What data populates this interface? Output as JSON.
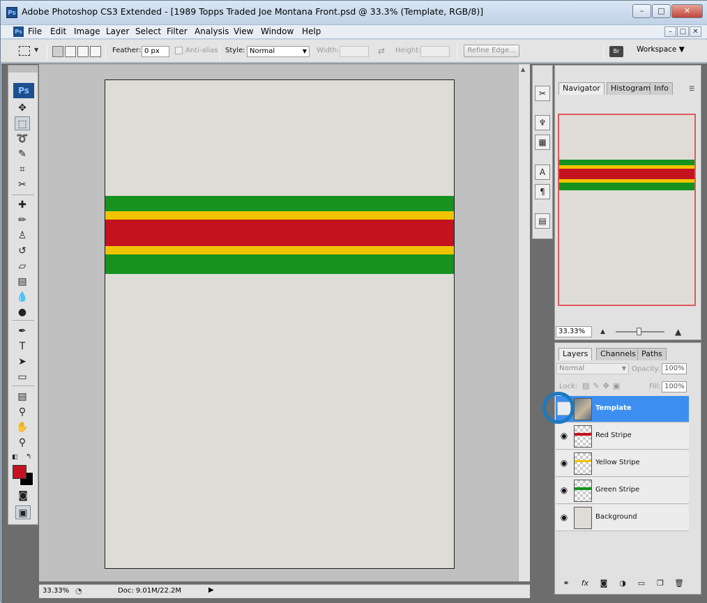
{
  "window": {
    "title": "Adobe Photoshop CS3 Extended - [1989 Topps Traded Joe Montana Front.psd @ 33.3% (Template, RGB/8)]",
    "app_icon": "Ps",
    "controls": {
      "minimize": "–",
      "maximize": "□",
      "close": "✕"
    }
  },
  "menubar": {
    "items": [
      "File",
      "Edit",
      "Image",
      "Layer",
      "Select",
      "Filter",
      "Analysis",
      "View",
      "Window",
      "Help"
    ]
  },
  "options": {
    "feather_label": "Feather:",
    "feather_value": "0 px",
    "antialias_label": "Anti-alias",
    "style_label": "Style:",
    "style_value": "Normal",
    "width_label": "Width:",
    "height_label": "Height:",
    "refine_edge": "Refine Edge...",
    "workspace": "Workspace ▼"
  },
  "toolbox": {
    "logo": "Ps",
    "tools": [
      {
        "name": "move-tool",
        "glyph": "✥"
      },
      {
        "name": "rectangular-marquee-tool",
        "glyph": "⬚",
        "active": true
      },
      {
        "name": "lasso-tool",
        "glyph": "➰"
      },
      {
        "name": "magic-wand-tool",
        "glyph": "✎"
      },
      {
        "name": "crop-tool",
        "glyph": "⌗"
      },
      {
        "name": "slice-tool",
        "glyph": "✂"
      },
      {
        "name": "healing-brush-tool",
        "glyph": "✚"
      },
      {
        "name": "brush-tool",
        "glyph": "✏"
      },
      {
        "name": "clone-stamp-tool",
        "glyph": "♙"
      },
      {
        "name": "history-brush-tool",
        "glyph": "↺"
      },
      {
        "name": "eraser-tool",
        "glyph": "▱"
      },
      {
        "name": "gradient-tool",
        "glyph": "▤"
      },
      {
        "name": "blur-tool",
        "glyph": "💧"
      },
      {
        "name": "dodge-tool",
        "glyph": "●"
      },
      {
        "name": "pen-tool",
        "glyph": "✒"
      },
      {
        "name": "type-tool",
        "glyph": "T"
      },
      {
        "name": "path-selection-tool",
        "glyph": "➤"
      },
      {
        "name": "shape-tool",
        "glyph": "▭"
      },
      {
        "name": "notes-tool",
        "glyph": "▤"
      },
      {
        "name": "eyedropper-tool",
        "glyph": "⚲"
      },
      {
        "name": "hand-tool",
        "glyph": "✋"
      },
      {
        "name": "zoom-tool",
        "glyph": "⚲"
      }
    ],
    "foreground_color": "#c4121f",
    "background_color": "#000000"
  },
  "document": {
    "background": "#dfdcd7",
    "stripes": [
      {
        "name": "green",
        "color": "#15921f"
      },
      {
        "name": "yellow",
        "color": "#f0c400"
      },
      {
        "name": "red",
        "color": "#c4121f"
      },
      {
        "name": "yellow",
        "color": "#f0c400"
      },
      {
        "name": "green",
        "color": "#15921f"
      }
    ]
  },
  "status": {
    "zoom": "33.33%",
    "doc": "Doc: 9.01M/22.2M"
  },
  "navigator": {
    "tabs": [
      "Navigator",
      "Histogram",
      "Info"
    ],
    "zoom": "33.33%"
  },
  "layers": {
    "tabs": [
      "Layers",
      "Channels",
      "Paths"
    ],
    "blend_mode": "Normal",
    "opacity_label": "Opacity:",
    "opacity_value": "100%",
    "lock_label": "Lock:",
    "fill_label": "Fill:",
    "fill_value": "100%",
    "items": [
      {
        "name": "Template",
        "visible": false,
        "selected": true
      },
      {
        "name": "Red Stripe",
        "visible": true,
        "selected": false
      },
      {
        "name": "Yellow Stripe",
        "visible": true,
        "selected": false
      },
      {
        "name": "Green Stripe",
        "visible": true,
        "selected": false
      },
      {
        "name": "Background",
        "visible": true,
        "selected": false
      }
    ]
  }
}
